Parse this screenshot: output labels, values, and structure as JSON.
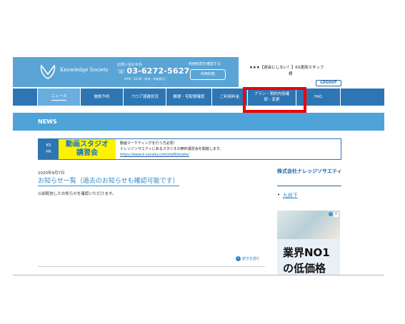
{
  "header": {
    "brand": "Knowledge Society",
    "contact_label": "お問い合わせ先",
    "phone": "03-6272-5627",
    "hours": "9:00 - 22:00（年末・年始休日）",
    "rules_label": "利用約款を確認する",
    "rules_button": "利用約款",
    "user_line1": "★★★【遅会にしない！】KS運用スタッフ",
    "user_line2": "様",
    "logout": "LOGOUT"
  },
  "nav": {
    "items": [
      {
        "label": "ニュース"
      },
      {
        "label": "施設予約"
      },
      {
        "label": "フロア混雑状況"
      },
      {
        "label": "郵便・宅配便確認"
      },
      {
        "label": "ご利用料金"
      },
      {
        "label": "プラン・契約内容確認・変更"
      },
      {
        "label": "FAQ"
      }
    ]
  },
  "news_band": {
    "title": "NEWS"
  },
  "pr_banner": {
    "tag_line1": "KS",
    "tag_line2": "PR",
    "studio_line1": "動画スタジオ",
    "studio_line2": "講習会",
    "text_line1": "動画マーケティングを行う方必見！",
    "text_line2": "ナレッジソサエティにあるスタジオの無料講習会を開催します。",
    "link": "https://www.k-society.com/staff/studio/"
  },
  "article": {
    "date": "2020年9月7日",
    "title": "お知らせ一覧（過去のお知らせも確認可能です）",
    "body": "以前配信したお知らせを確認いただけます。",
    "read_more": "続きを読む"
  },
  "sidebar": {
    "company": "株式会社ナレッジソサエティ",
    "items": [
      {
        "label": "九段下"
      }
    ]
  },
  "ad": {
    "line1": "業界NO1",
    "line2": "の低価格"
  },
  "colors": {
    "header_blue": "#5aa4d6",
    "nav_blue": "#2e75b4",
    "highlight_red": "#ee0000",
    "banner_yellow": "#fff200"
  }
}
